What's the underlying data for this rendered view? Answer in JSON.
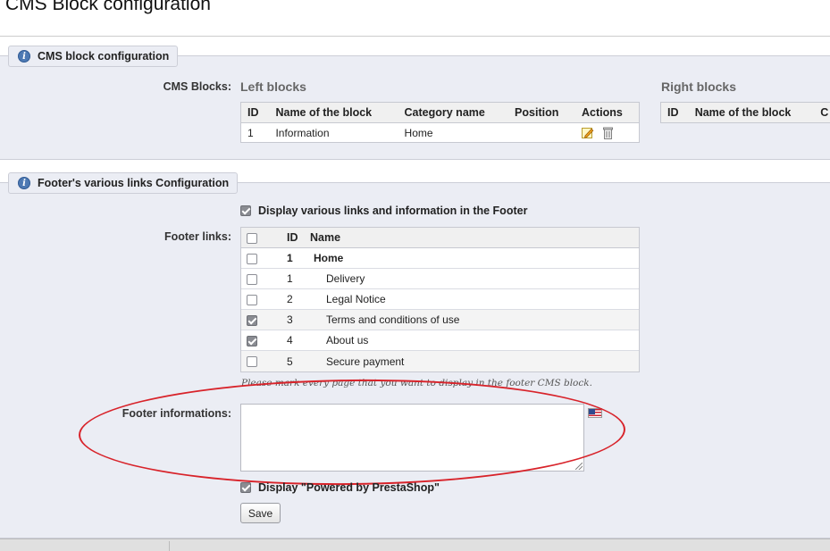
{
  "page": {
    "title": "CMS Block configuration"
  },
  "cms_section": {
    "legend": "CMS block configuration",
    "cms_blocks_label": "CMS Blocks:",
    "left": {
      "title": "Left blocks",
      "columns": [
        "ID",
        "Name of the block",
        "Category name",
        "Position",
        "Actions"
      ],
      "rows": [
        {
          "id": "1",
          "name": "Information",
          "category": "Home",
          "position": ""
        }
      ]
    },
    "right": {
      "title": "Right blocks",
      "columns": [
        "ID",
        "Name of the block",
        "C"
      ]
    }
  },
  "footer_section": {
    "legend": "Footer's various links Configuration",
    "display_links_label": "Display various links and information in the Footer",
    "display_links_checked": true,
    "footer_links_label": "Footer links:",
    "links_columns": [
      "ID",
      "Name"
    ],
    "links": [
      {
        "id": "1",
        "name": "Home",
        "checked": false,
        "bold": true
      },
      {
        "id": "1",
        "name": "Delivery",
        "checked": false
      },
      {
        "id": "2",
        "name": "Legal Notice",
        "checked": false
      },
      {
        "id": "3",
        "name": "Terms and conditions of use",
        "checked": true
      },
      {
        "id": "4",
        "name": "About us",
        "checked": true
      },
      {
        "id": "5",
        "name": "Secure payment",
        "checked": false
      }
    ],
    "links_hint": "Please mark every page that you want to display in the footer CMS block.",
    "footer_info_label": "Footer informations:",
    "footer_info_value": "",
    "powered_by_label": "Display \"Powered by PrestaShop\"",
    "powered_by_checked": true,
    "save_label": "Save"
  },
  "icons": {
    "legend_icon": "info-icon",
    "edit": "pencil-icon",
    "delete": "trash-icon",
    "language": "us-flag-icon"
  },
  "colors": {
    "panel_bg": "#ebedf4",
    "annotation": "#d8232a"
  }
}
